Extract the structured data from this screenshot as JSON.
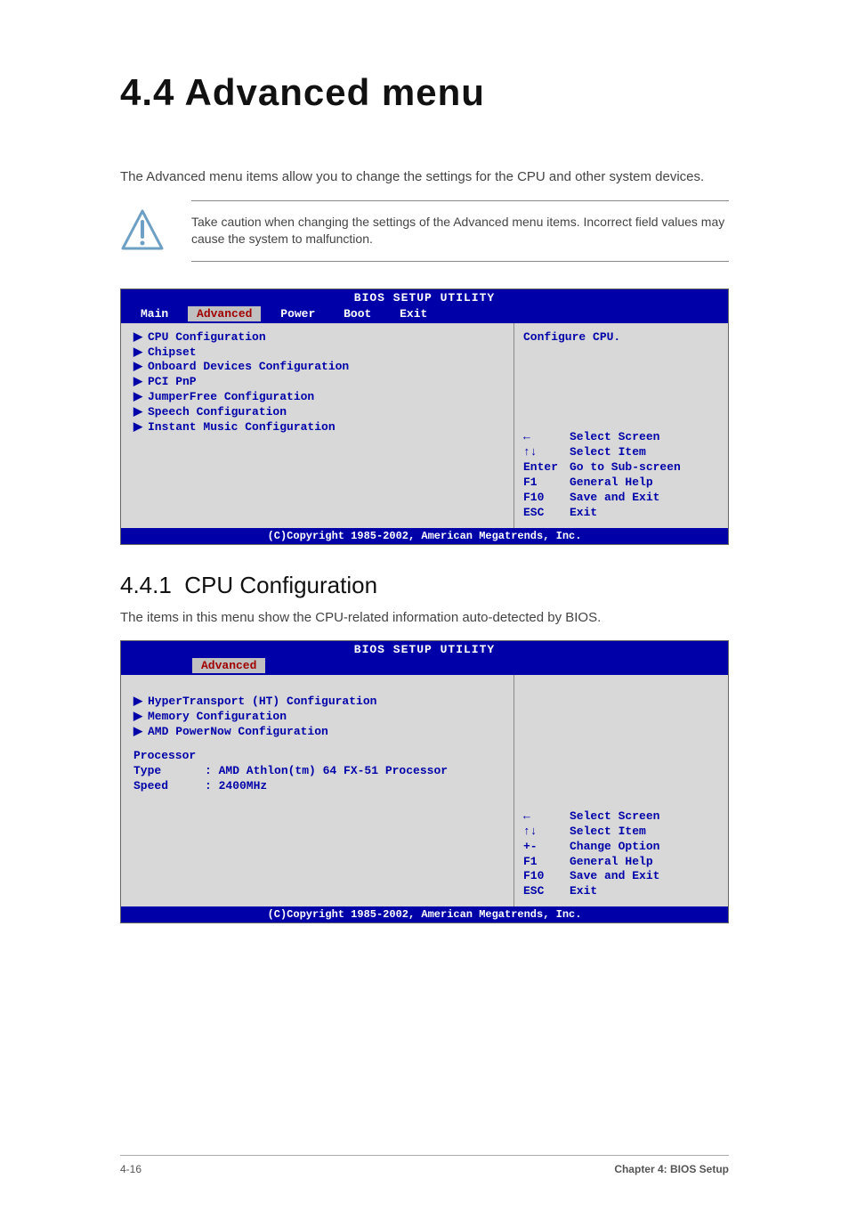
{
  "heading": "4.4   Advanced menu",
  "intro": "The Advanced menu items allow you to change the settings for the CPU and other system devices.",
  "warning": "Take caution when changing the settings of the Advanced menu items. Incorrect field values may cause the system to malfunction.",
  "bios1": {
    "title": "BIOS SETUP UTILITY",
    "tabs": [
      "Main",
      "Advanced",
      "Power",
      "Boot",
      "Exit"
    ],
    "active_tab": "Advanced",
    "items": [
      "CPU Configuration",
      "Chipset",
      "Onboard Devices Configuration",
      "PCI PnP",
      "JumperFree Configuration",
      "Speech Configuration",
      "Instant Music Configuration"
    ],
    "help_top": "Configure CPU.",
    "help_keys": [
      {
        "k": "←",
        "d": "Select Screen"
      },
      {
        "k": "↑↓",
        "d": "Select Item"
      },
      {
        "k": "Enter",
        "d": "Go to Sub-screen"
      },
      {
        "k": "F1",
        "d": "General Help"
      },
      {
        "k": "F10",
        "d": "Save and Exit"
      },
      {
        "k": "ESC",
        "d": "Exit"
      }
    ],
    "footer": "(C)Copyright 1985-2002, American Megatrends, Inc."
  },
  "section_num": "4.4.1",
  "section_title": "CPU Configuration",
  "section_desc": "The items in this menu show the CPU-related information auto-detected by BIOS.",
  "bios2": {
    "title": "BIOS SETUP UTILITY",
    "tabs": [
      "Advanced"
    ],
    "active_tab": "Advanced",
    "items": [
      "HyperTransport (HT) Configuration",
      "Memory Configuration",
      "AMD PowerNow Configuration"
    ],
    "info_label": "Processor",
    "type_label": "Type",
    "type_value": ": AMD Athlon(tm) 64 FX-51 Processor",
    "speed_label": "Speed",
    "speed_value": ": 2400MHz",
    "help_keys": [
      {
        "k": "←",
        "d": "Select Screen"
      },
      {
        "k": "↑↓",
        "d": "Select Item"
      },
      {
        "k": "+-",
        "d": "Change Option"
      },
      {
        "k": "F1",
        "d": "General Help"
      },
      {
        "k": "F10",
        "d": "Save and Exit"
      },
      {
        "k": "ESC",
        "d": "Exit"
      }
    ],
    "footer": "(C)Copyright 1985-2002, American Megatrends, Inc."
  },
  "foot_left": "4-16",
  "foot_right": "Chapter 4: BIOS Setup"
}
